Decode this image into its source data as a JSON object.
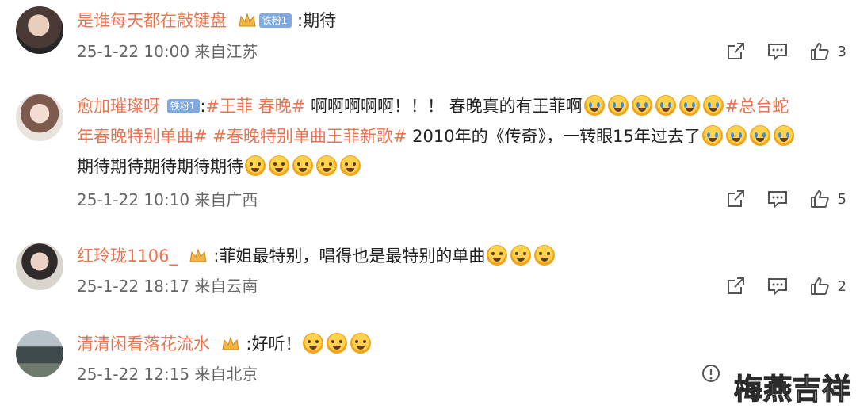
{
  "comments": [
    {
      "username": "是谁每天都在敲键盘",
      "badge": "铁粉1",
      "text": ":期待",
      "time": "25-1-22 10:00 来自江苏",
      "likes": "3"
    },
    {
      "username": "愈加璀璨呀",
      "badge": "铁粉1",
      "text_prefix": ":",
      "hashtag1": "#王菲 春晚#",
      "text1": " 啊啊啊啊啊！！！ 春晚真的有王菲啊",
      "hashtag2a": "#总台蛇",
      "hashtag2b": "年春晚特别单曲#",
      "hashtag3": "#春晚特别单曲王菲新歌#",
      "text2": " 2010年的《传奇》，一转眼15年过去了",
      "text3": "期待期待期待期待期待",
      "time": "25-1-22 10:10 来自广西",
      "likes": "5"
    },
    {
      "username": "红玲珑1106_",
      "text": ":菲姐最特别，唱得也是最特别的单曲",
      "time": "25-1-22 18:17 来自云南",
      "likes": "2"
    },
    {
      "username": "清清闲看落花流水",
      "text": ":好听！",
      "time": "25-1-22 12:15 来自北京"
    }
  ],
  "watermark": "梅燕吉祥",
  "colors": {
    "username": "#eb7350",
    "badge": "#7fa9e0"
  }
}
